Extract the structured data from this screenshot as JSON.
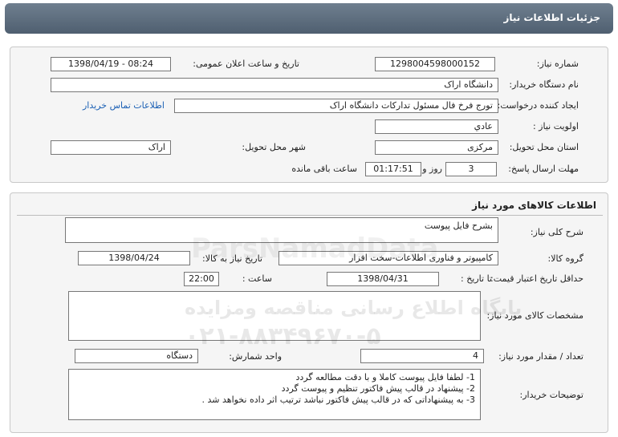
{
  "header": {
    "title": "جزئیات اطلاعات نیاز"
  },
  "info": {
    "need_number_label": "شماره نیاز:",
    "need_number": "1298004598000152",
    "announce_label": "تاریخ و ساعت اعلان عمومی:",
    "announce_value": "1398/04/19 - 08:24",
    "buyer_org_label": "نام دستگاه خریدار:",
    "buyer_org": "دانشگاه اراک",
    "requester_label": "ایجاد کننده درخواست:",
    "requester": "تورج فرخ فال مسئول تدارکات دانشگاه اراک",
    "contact_link": "اطلاعات تماس خریدار",
    "priority_label": "اولویت نیاز :",
    "priority": "عادي",
    "province_label": "استان محل تحویل:",
    "province": "مرکزی",
    "city_label": "شهر محل تحویل:",
    "city": "اراک",
    "deadline_label": "مهلت ارسال پاسخ:",
    "days": "3",
    "days_word": "روز و",
    "time_left": "01:17:51",
    "time_left_word": "ساعت باقی مانده"
  },
  "goods": {
    "section_title": "اطلاعات کالاهای مورد نیاز",
    "summary_label": "شرح کلی نیاز:",
    "summary": "بشرح فایل پیوست",
    "group_label": "گروه کالا:",
    "group": "کامپیوتر و فناوری اطلاعات-سخت افزار",
    "need_date_label": "تاریخ نیاز به کالا:",
    "need_date": "1398/04/24",
    "min_validity_label": "حداقل تاریخ اعتبار قیمت:",
    "until_date_label": "تا تاریخ :",
    "until_date": "1398/04/31",
    "hour_label": "ساعت :",
    "hour": "22:00",
    "specs_label": "مشخصات کالای مورد نیاز:",
    "specs": "",
    "qty_label": "تعداد / مقدار مورد نیاز:",
    "qty": "4",
    "unit_label": "واحد شمارش:",
    "unit": "دستگاه",
    "notes_label": "توضیحات خریدار:",
    "notes": [
      "1- لطفا فایل پیوست کاملا و با دقت مطالعه گردد",
      "2- پیشنهاد در قالب پیش فاکتور تنظیم و پیوست گردد",
      "3- به پیشنهاداتی که در قالب پیش فاکتور نباشد ترتیب اثر داده نخواهد شد ."
    ]
  },
  "watermark": {
    "logo_text": "ParsNamadData",
    "line1": "پایگاه اطلاع رسانی مناقصه ومزایده",
    "line2": "۰۲۱-۸۸۳۴۹۶۷۰-۵"
  }
}
